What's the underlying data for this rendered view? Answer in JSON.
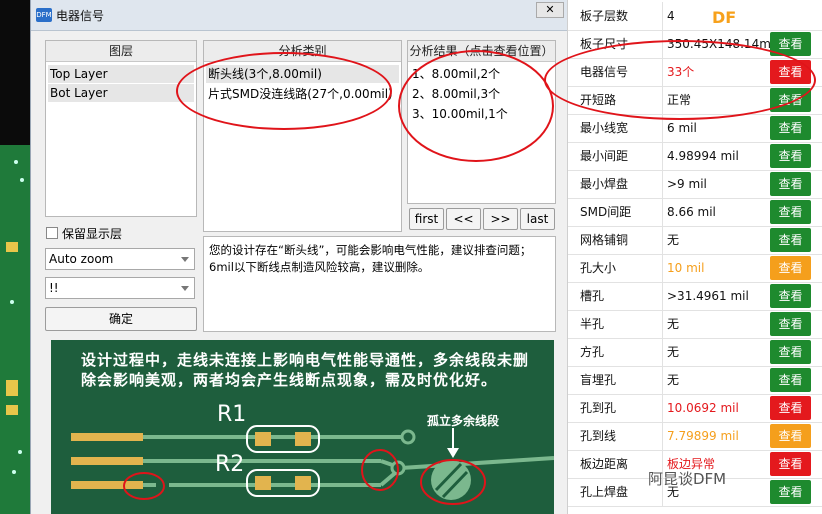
{
  "window": {
    "title": "电器信号",
    "icon_label": "DFM"
  },
  "layers": {
    "header": "图层",
    "items": [
      "Top Layer",
      "Bot Layer"
    ]
  },
  "analysis": {
    "header": "分析类别",
    "items": [
      "断头线(3个,8.00mil)",
      "片式SMD没连线路(27个,0.00mil)"
    ]
  },
  "results": {
    "header": "分析结果（点击查看位置）",
    "items": [
      "1、8.00mil,2个",
      "2、8.00mil,3个",
      "3、10.00mil,1个"
    ]
  },
  "nav": {
    "first": "first",
    "prev": "<<",
    "next": ">>",
    "last": "last"
  },
  "options": {
    "keep_layers_label": "保留显示层",
    "zoom_value": "Auto zoom",
    "filter_value": "!!",
    "ok_label": "确定"
  },
  "message": "您的设计存在“断头线”，可能会影响电气性能，建议排查问题；6mil以下断线点制造风险较高，建议删除。",
  "illustration": {
    "text": "设计过程中，走线未连接上影响电气性能导通性，多余线段未删除会影响美观，两者均会产生线断点现象，需及时优化好。",
    "r1": "R1",
    "r2": "R2",
    "annotation": "孤立多余线段"
  },
  "df_mark": "DF",
  "view_label": "查看",
  "table": [
    {
      "name": "板子层数",
      "value": "4",
      "btn": ""
    },
    {
      "name": "板子尺寸",
      "value": "350.45X148.14mm",
      "btn": "g"
    },
    {
      "name": "电器信号",
      "value": "33个",
      "btn": "r",
      "value_color": "#e4191d"
    },
    {
      "name": "开短路",
      "value": "正常",
      "btn": "g"
    },
    {
      "name": "最小线宽",
      "value": "6 mil",
      "btn": "g"
    },
    {
      "name": "最小间距",
      "value": "4.98994 mil",
      "btn": "g"
    },
    {
      "name": "最小焊盘",
      "value": ">9 mil",
      "btn": "g"
    },
    {
      "name": "SMD间距",
      "value": "8.66 mil",
      "btn": "g"
    },
    {
      "name": "网格铺铜",
      "value": "无",
      "btn": "g"
    },
    {
      "name": "孔大小",
      "value": "10 mil",
      "btn": "o",
      "value_color": "#f59f1c"
    },
    {
      "name": "槽孔",
      "value": ">31.4961 mil",
      "btn": "g"
    },
    {
      "name": "半孔",
      "value": "无",
      "btn": "g"
    },
    {
      "name": "方孔",
      "value": "无",
      "btn": "g"
    },
    {
      "name": "盲埋孔",
      "value": "无",
      "btn": "g"
    },
    {
      "name": "孔到孔",
      "value": "10.0692 mil",
      "btn": "r",
      "value_color": "#e4191d"
    },
    {
      "name": "孔到线",
      "value": "7.79899 mil",
      "btn": "o",
      "value_color": "#f59f1c"
    },
    {
      "name": "板边距离",
      "value": "板边异常",
      "btn": "r",
      "value_color": "#e4191d"
    },
    {
      "name": "孔上焊盘",
      "value": "无",
      "btn": "g"
    }
  ],
  "watermark": "阿昆谈DFM"
}
